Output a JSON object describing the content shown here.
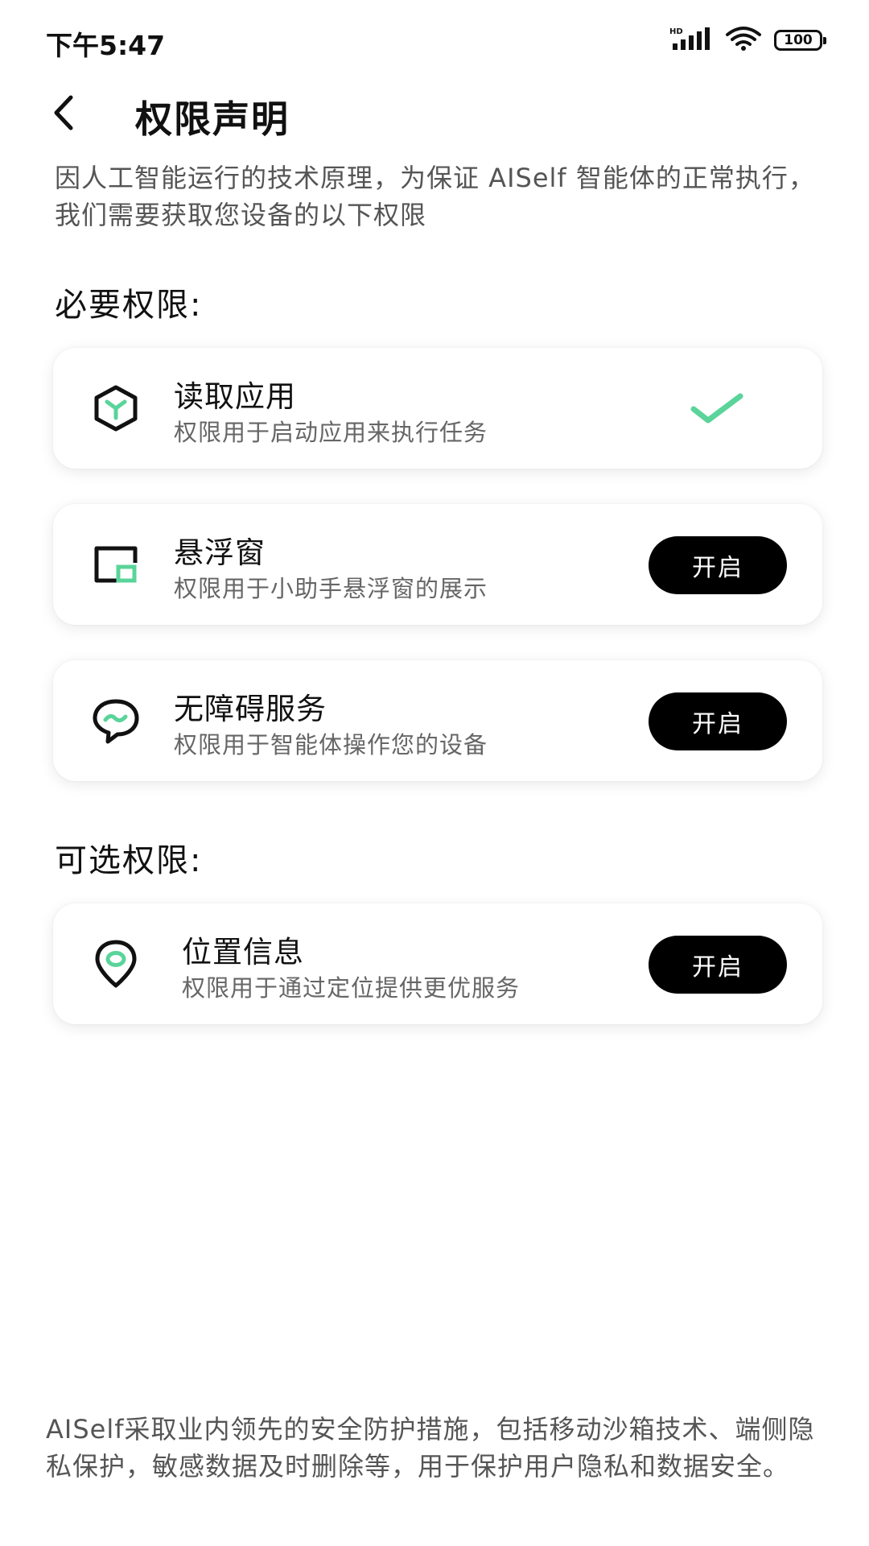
{
  "status_bar": {
    "time": "下午5:47",
    "network_badge": "HD",
    "battery": "100",
    "icons": [
      "signal-icon",
      "wifi-icon",
      "battery-icon"
    ]
  },
  "header": {
    "back_icon": "chevron-left-icon",
    "title": "权限声明"
  },
  "intro": "因人工智能运行的技术原理，为保证 AISelf 智能体的正常执行，我们需要获取您设备的以下权限",
  "required": {
    "title": "必要权限:",
    "items": [
      {
        "icon": "app-cube-icon",
        "title": "读取应用",
        "desc": "权限用于启动应用来执行任务",
        "state": "granted"
      },
      {
        "icon": "floating-window-icon",
        "title": "悬浮窗",
        "desc": "权限用于小助手悬浮窗的展示",
        "button": "开启"
      },
      {
        "icon": "chat-bubble-icon",
        "title": "无障碍服务",
        "desc": "权限用于智能体操作您的设备",
        "button": "开启"
      }
    ]
  },
  "optional": {
    "title": "可选权限:",
    "items": [
      {
        "icon": "location-pin-icon",
        "title": "位置信息",
        "desc": "权限用于通过定位提供更优服务",
        "button": "开启"
      }
    ]
  },
  "footer": "AISelf采取业内领先的安全防护措施，包括移动沙箱技术、端侧隐私保护，敏感数据及时删除等，用于保护用户隐私和数据安全。",
  "colors": {
    "accent": "#5ad49a",
    "button_bg": "#000000",
    "button_text": "#ffffff"
  }
}
